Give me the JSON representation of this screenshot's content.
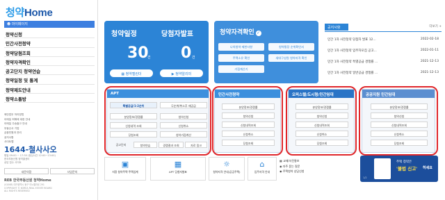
{
  "sidebar": {
    "logo_prefix": "청약",
    "logo_suffix": "Home",
    "mypage": "마이페이지",
    "menu": [
      "청약신청",
      "민간사전청약",
      "청약당첨조회",
      "청약자격확인",
      "공고단지 청약연습",
      "청약일정 및 통계",
      "청약제도안내",
      "청약소통방"
    ],
    "links": [
      "매안업무 처리방법",
      "이메일 피해에 대한 안내",
      "이메일 주송출고 안내",
      "부동산사 기업",
      "금융민원과 관리",
      "공지사항",
      "사이트맵"
    ],
    "phone": "1644-철사사오",
    "phone_info": [
      "평일 09:00 ~ 17:30 (점심시간 12:00~13:00)",
      "한국부동산원 청약콜센터",
      "상담 접수 사이트"
    ],
    "btn_left": "내문의함",
    "btn_right": "사업문의",
    "foot_logo": "REB 한국부동산원 청약Home",
    "copyright": [
      "(41068) 대구광역시 동구 이노밸리로 291",
      "COPYRIGHT © KOREA REAL ESTATE BOARD",
      "ALL RIGHTS RESERVED"
    ]
  },
  "schedule": {
    "title_left": "청약일정",
    "title_right": "당첨자발표",
    "count_left": "30",
    "count_right": "0",
    "unit": "건",
    "btn_left": "청약캘린더",
    "btn_right": "청약알리미"
  },
  "eligibility": {
    "title": "청약자격확인",
    "buttons": [
      "나의청약 제한사항",
      "청약통장 순위확인서",
      "주택소유 확인",
      "세대구성원 청약자격 확인",
      "가점계산기"
    ]
  },
  "notice": {
    "tab": "공지사항",
    "more": "더보기 +",
    "items": [
      {
        "title": "민간 1차 사전청약 당첨자 발표 12...",
        "date": "2022-02-18"
      },
      {
        "title": "민간 1차 사전청약 입주자모집 공고...",
        "date": "2022-01-11"
      },
      {
        "title": "민간 1차 사전청약 특별공급 경쟁률 ...",
        "date": "2021-12-13"
      },
      {
        "title": "민간 1차 사전청약 일반공급 경쟁률 ...",
        "date": "2021-12-13"
      }
    ]
  },
  "apt": {
    "header": "APT",
    "tab_active": "특별공급/1·2순위",
    "tab_other": "무순위/취소후 재공급",
    "rows": [
      [
        "분양정보/경쟁률",
        "청약신청"
      ],
      [
        "신청내역 조회",
        "신청취소"
      ],
      [
        "당첨조회",
        "청약가점계산"
      ]
    ],
    "bottom": [
      "공고단지",
      "청약연습",
      "경쟁결과 조회",
      "자료 링크"
    ]
  },
  "private": {
    "header": "민간사전청약",
    "rows": [
      "분양정보/경쟁률",
      "청약신청",
      "신청내역조회",
      "신청취소",
      "당첨조회"
    ]
  },
  "officetel": {
    "header": "오피스텔/도시형/민간임대",
    "rows": [
      "분양정보/경쟁률",
      "청약신청",
      "신청내역조회",
      "신청취소",
      "당첨조회"
    ]
  },
  "public": {
    "header": "공공지원 민간임대",
    "rows": [
      "분양정보/경쟁률",
      "청약신청",
      "신청내역조회",
      "신청취소",
      "당첨조회"
    ]
  },
  "bottom_links": [
    {
      "icon": "building-icon",
      "label": "지정 청약주택 주택업계"
    },
    {
      "icon": "apartment-icon",
      "label": "APT 당첨자발표"
    },
    {
      "icon": "handshake-icon",
      "label": "청약자격 안내(공공주택)"
    },
    {
      "icon": "house-icon",
      "label": "입주자격 안내"
    }
  ],
  "help_list": [
    "교재/사진통보",
    "자주 묻는 질문",
    "주택청약 상담신청"
  ],
  "banner": {
    "line1": "주택 청약은",
    "line2": "'불법 신고'",
    "line3": "하세요",
    "pager": "1/2"
  },
  "colors": {
    "accent": "#2c84d6",
    "highlight": "#e0262a"
  }
}
